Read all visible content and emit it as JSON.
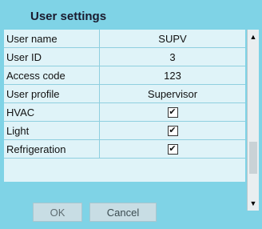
{
  "title": "User settings",
  "rows": [
    {
      "label": "User name",
      "value": "SUPV"
    },
    {
      "label": "User ID",
      "value": "3"
    },
    {
      "label": "Access code",
      "value": "123"
    },
    {
      "label": "User profile",
      "value": "Supervisor"
    },
    {
      "label": "HVAC",
      "checked": true
    },
    {
      "label": "Light",
      "checked": true
    },
    {
      "label": "Refrigeration",
      "checked": true
    }
  ],
  "buttons": {
    "ok": "OK",
    "cancel": "Cancel"
  },
  "scroll": {
    "up_icon": "up-arrow",
    "down_icon": "down-arrow"
  },
  "colors": {
    "panel": "#7fd3e6",
    "grid": "#dff3f8"
  }
}
